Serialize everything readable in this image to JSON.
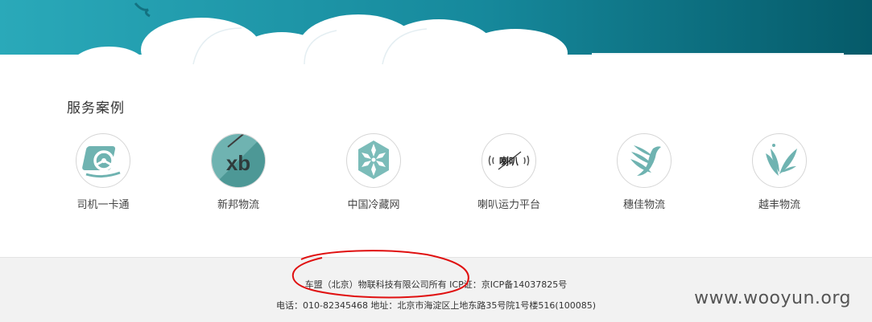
{
  "section": {
    "title": "服务案例"
  },
  "cases": [
    {
      "label": "司机一卡通",
      "icon": "steering-wheel-logo-icon"
    },
    {
      "label": "新邦物流",
      "icon": "xb-logo-icon"
    },
    {
      "label": "中国冷藏网",
      "icon": "snowflake-logo-icon"
    },
    {
      "label": "喇叭运力平台",
      "icon": "labayun-logo-icon"
    },
    {
      "label": "穗佳物流",
      "icon": "bird-wing-logo-icon"
    },
    {
      "label": "越丰物流",
      "icon": "leaf-bird-logo-icon"
    }
  ],
  "logo_text": {
    "xb": "xb",
    "laba": "喇叭"
  },
  "footer": {
    "copyright": "车盟（北京）物联科技有限公司所有 ICP证：京ICP备14037825号",
    "contact": "电话：010-82345468 地址：北京市海淀区上地东路35号院1号楼516(100085)"
  },
  "watermark": "www.wooyun.org",
  "colors": {
    "banner_start": "#2aa7b7",
    "banner_end": "#066070",
    "logo_teal": "#6fb3b1",
    "annotation_red": "#e01010"
  }
}
